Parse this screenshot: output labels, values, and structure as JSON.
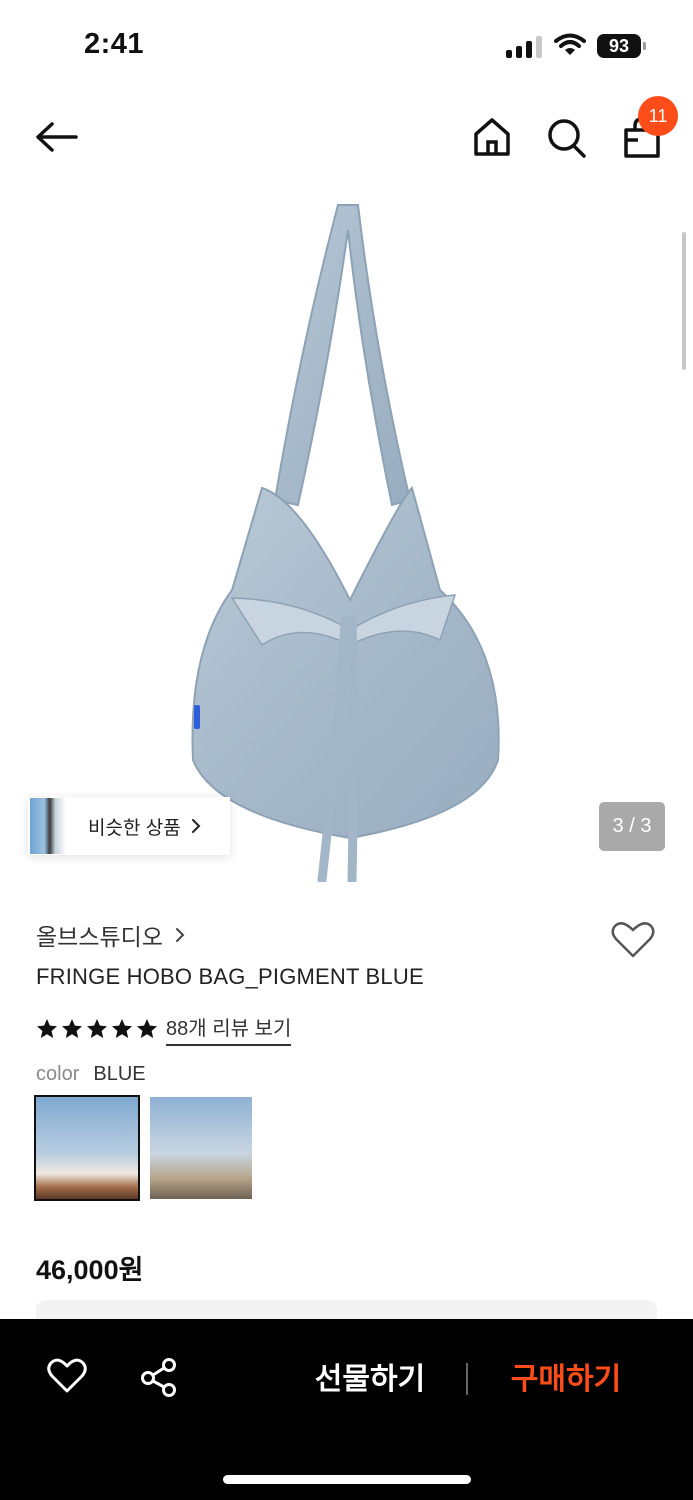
{
  "status_bar": {
    "time": "2:41",
    "battery": "93",
    "signal_icon": "cellular-signal-icon",
    "wifi_icon": "wifi-icon"
  },
  "header": {
    "back_icon": "arrow-left-icon",
    "home_icon": "home-icon",
    "search_icon": "search-icon",
    "cart_icon": "shopping-bag-icon",
    "cart_count": "11"
  },
  "gallery": {
    "similar_label": "비슷한 상품",
    "page_counter": "3 / 3"
  },
  "product": {
    "brand": "올브스튜디오",
    "title": "FRINGE HOBO BAG_PIGMENT BLUE",
    "rating": 5,
    "review_link": "88개 리뷰 보기",
    "option_label": "color",
    "option_value": "BLUE",
    "price": "46,000원"
  },
  "bottom_bar": {
    "gift_label": "선물하기",
    "buy_label": "구매하기"
  },
  "colors": {
    "accent": "#ff4d1a",
    "bag_denim": "#a9bccd"
  }
}
